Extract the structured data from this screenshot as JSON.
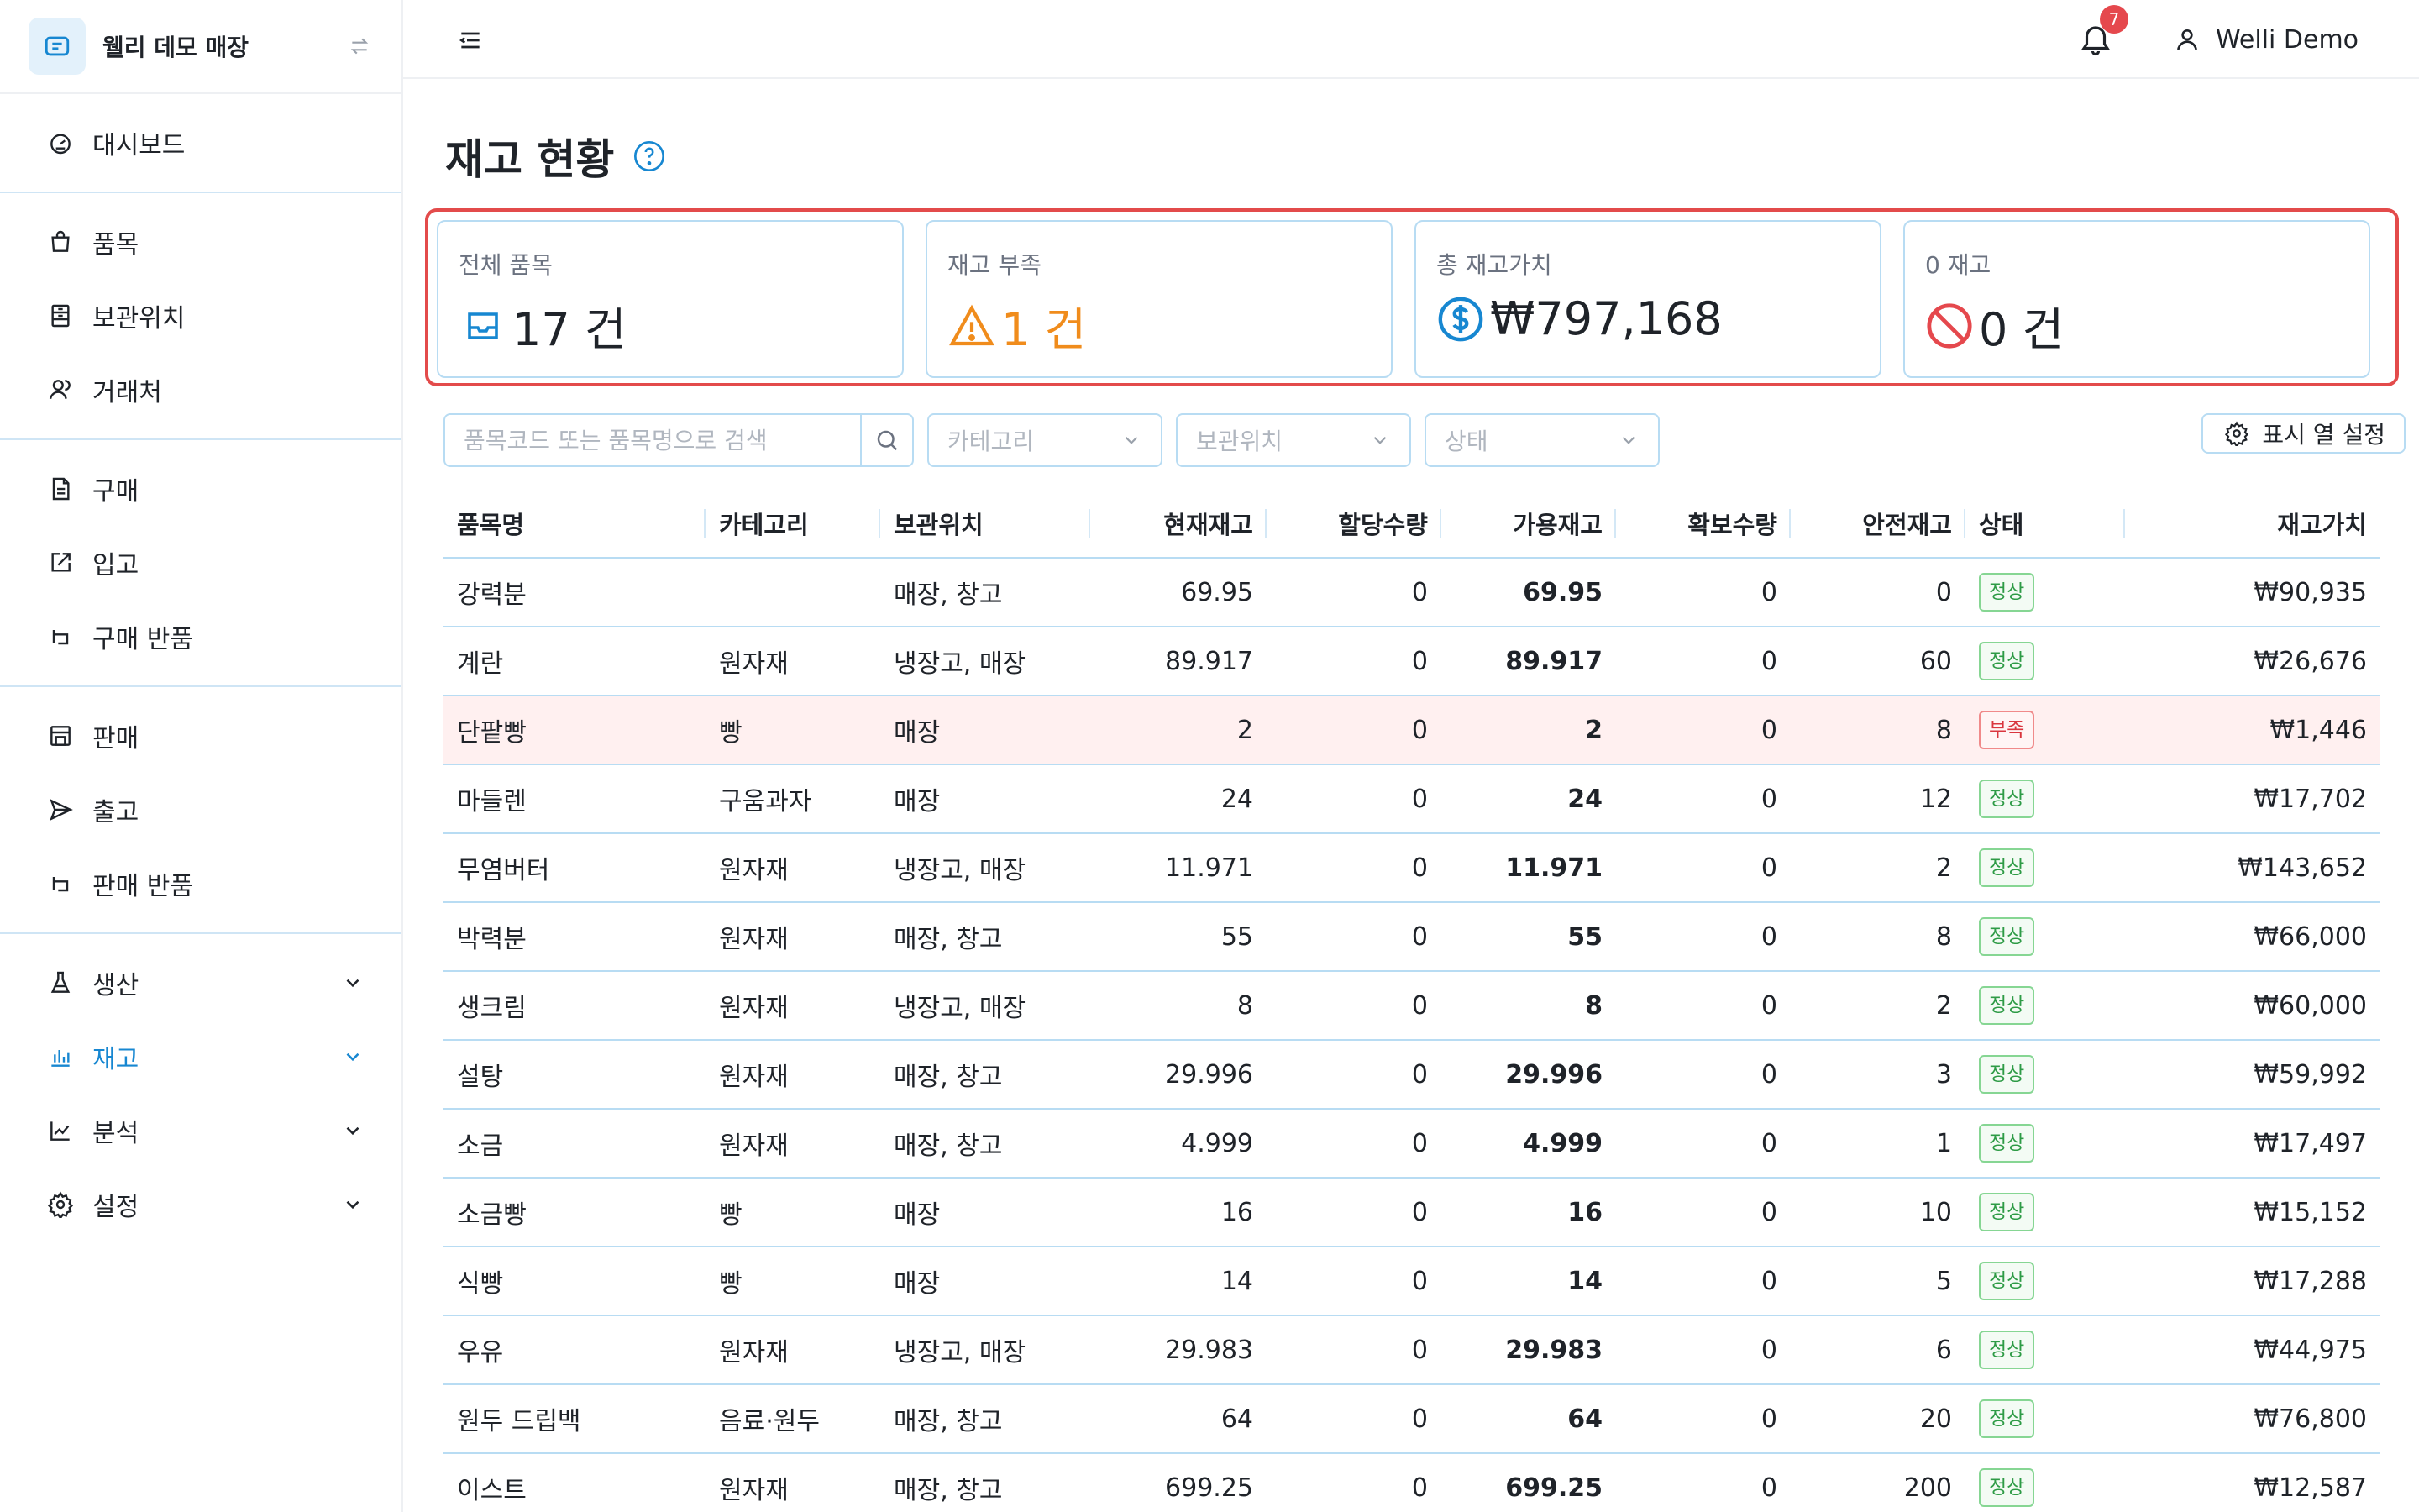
{
  "brand": {
    "name": "웰리 데모 매장"
  },
  "nav": {
    "groups": [
      [
        {
          "label": "대시보드",
          "icon": "gauge-icon"
        }
      ],
      [
        {
          "label": "품목",
          "icon": "bag-icon"
        },
        {
          "label": "보관위치",
          "icon": "storage-icon"
        },
        {
          "label": "거래처",
          "icon": "people-icon"
        }
      ],
      [
        {
          "label": "구매",
          "icon": "document-icon"
        },
        {
          "label": "입고",
          "icon": "edit-box-icon"
        },
        {
          "label": "구매 반품",
          "icon": "return-icon"
        }
      ],
      [
        {
          "label": "판매",
          "icon": "store-icon"
        },
        {
          "label": "출고",
          "icon": "send-icon"
        },
        {
          "label": "판매 반품",
          "icon": "return-icon"
        }
      ],
      [
        {
          "label": "생산",
          "icon": "flask-icon"
        },
        {
          "label": "재고",
          "icon": "bar-chart-icon"
        },
        {
          "label": "분석",
          "icon": "line-chart-icon"
        },
        {
          "label": "설정",
          "icon": "gear-icon"
        }
      ]
    ]
  },
  "header": {
    "notification_count": "7",
    "user_name": "Welli Demo"
  },
  "page": {
    "title": "재고 현황"
  },
  "stats": [
    {
      "label": "전체 품목",
      "value": "17 건",
      "icon": "inbox-icon",
      "color": "#1787d1"
    },
    {
      "label": "재고 부족",
      "value": "1 건",
      "icon": "warning-icon",
      "color": "#f08c1c"
    },
    {
      "label": "총 재고가치",
      "value": "₩797,168",
      "icon": "dollar-icon",
      "color": "#1787d1"
    },
    {
      "label": "0 재고",
      "value": "0 건",
      "icon": "forbidden-icon",
      "color": "#e5484d"
    }
  ],
  "filters": {
    "search_placeholder": "품목코드 또는 품목명으로 검색",
    "category": "카테고리",
    "location": "보관위치",
    "status": "상태",
    "column_settings": "표시 열 설정"
  },
  "table": {
    "columns": [
      "품목명",
      "카테고리",
      "보관위치",
      "현재재고",
      "할당수량",
      "가용재고",
      "확보수량",
      "안전재고",
      "상태",
      "재고가치"
    ],
    "rows": [
      {
        "name": "강력분",
        "category": "",
        "location": "매장, 창고",
        "current": "69.95",
        "allocated": "0",
        "available": "69.95",
        "secured": "0",
        "safety": "0",
        "status": "정상",
        "value": "₩90,935"
      },
      {
        "name": "계란",
        "category": "원자재",
        "location": "냉장고, 매장",
        "current": "89.917",
        "allocated": "0",
        "available": "89.917",
        "secured": "0",
        "safety": "60",
        "status": "정상",
        "value": "₩26,676"
      },
      {
        "name": "단팥빵",
        "category": "빵",
        "location": "매장",
        "current": "2",
        "allocated": "0",
        "available": "2",
        "secured": "0",
        "safety": "8",
        "status": "부족",
        "value": "₩1,446"
      },
      {
        "name": "마들렌",
        "category": "구움과자",
        "location": "매장",
        "current": "24",
        "allocated": "0",
        "available": "24",
        "secured": "0",
        "safety": "12",
        "status": "정상",
        "value": "₩17,702"
      },
      {
        "name": "무염버터",
        "category": "원자재",
        "location": "냉장고, 매장",
        "current": "11.971",
        "allocated": "0",
        "available": "11.971",
        "secured": "0",
        "safety": "2",
        "status": "정상",
        "value": "₩143,652"
      },
      {
        "name": "박력분",
        "category": "원자재",
        "location": "매장, 창고",
        "current": "55",
        "allocated": "0",
        "available": "55",
        "secured": "0",
        "safety": "8",
        "status": "정상",
        "value": "₩66,000"
      },
      {
        "name": "생크림",
        "category": "원자재",
        "location": "냉장고, 매장",
        "current": "8",
        "allocated": "0",
        "available": "8",
        "secured": "0",
        "safety": "2",
        "status": "정상",
        "value": "₩60,000"
      },
      {
        "name": "설탕",
        "category": "원자재",
        "location": "매장, 창고",
        "current": "29.996",
        "allocated": "0",
        "available": "29.996",
        "secured": "0",
        "safety": "3",
        "status": "정상",
        "value": "₩59,992"
      },
      {
        "name": "소금",
        "category": "원자재",
        "location": "매장, 창고",
        "current": "4.999",
        "allocated": "0",
        "available": "4.999",
        "secured": "0",
        "safety": "1",
        "status": "정상",
        "value": "₩17,497"
      },
      {
        "name": "소금빵",
        "category": "빵",
        "location": "매장",
        "current": "16",
        "allocated": "0",
        "available": "16",
        "secured": "0",
        "safety": "10",
        "status": "정상",
        "value": "₩15,152"
      },
      {
        "name": "식빵",
        "category": "빵",
        "location": "매장",
        "current": "14",
        "allocated": "0",
        "available": "14",
        "secured": "0",
        "safety": "5",
        "status": "정상",
        "value": "₩17,288"
      },
      {
        "name": "우유",
        "category": "원자재",
        "location": "냉장고, 매장",
        "current": "29.983",
        "allocated": "0",
        "available": "29.983",
        "secured": "0",
        "safety": "6",
        "status": "정상",
        "value": "₩44,975"
      },
      {
        "name": "원두 드립백",
        "category": "음료·원두",
        "location": "매장, 창고",
        "current": "64",
        "allocated": "0",
        "available": "64",
        "secured": "0",
        "safety": "20",
        "status": "정상",
        "value": "₩76,800"
      },
      {
        "name": "이스트",
        "category": "원자재",
        "location": "매장, 창고",
        "current": "699.25",
        "allocated": "0",
        "available": "699.25",
        "secured": "0",
        "safety": "200",
        "status": "정상",
        "value": "₩12,587"
      }
    ]
  }
}
